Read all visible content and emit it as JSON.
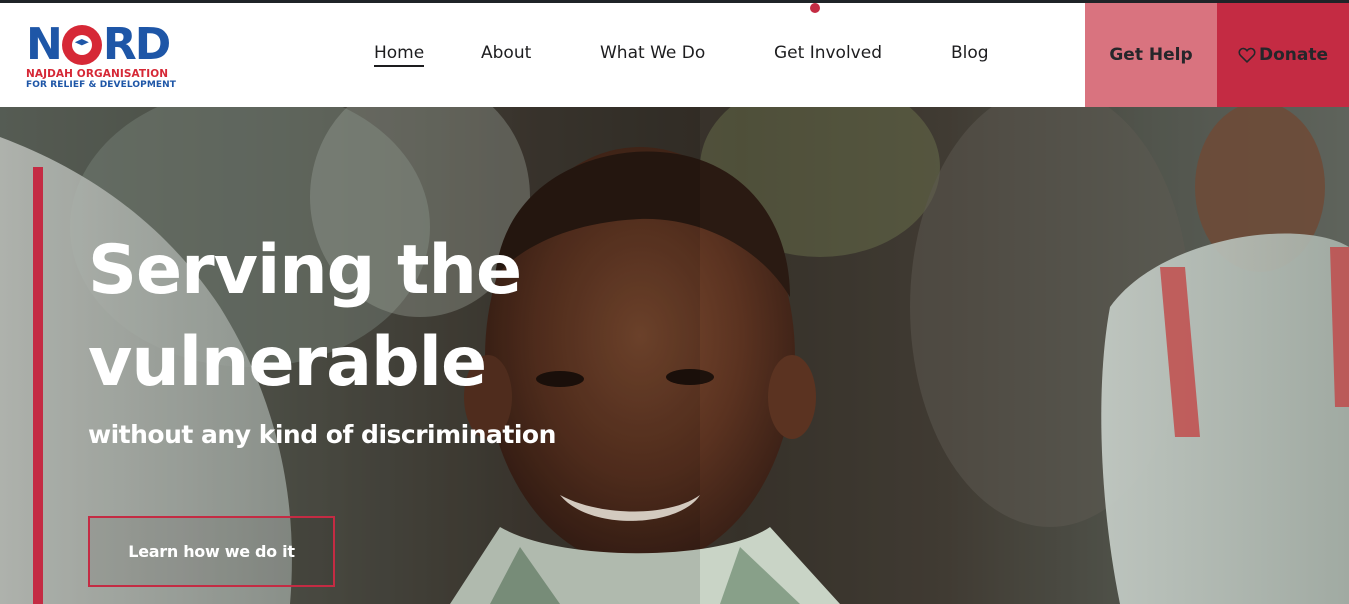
{
  "logo": {
    "word_left": "N",
    "word_right": "RD",
    "line1": "NAJDAH ORGANISATION",
    "line2": "FOR RELIEF & DEVELOPMENT"
  },
  "nav": {
    "items": [
      {
        "label": "Home",
        "active": true
      },
      {
        "label": "About"
      },
      {
        "label": "What We Do"
      },
      {
        "label": "Get Involved"
      },
      {
        "label": "Blog"
      }
    ]
  },
  "actions": {
    "help_label": "Get Help",
    "donate_label": "Donate"
  },
  "hero": {
    "title": "Serving the vulnerable",
    "subtitle": "without any kind of discrimination",
    "cta_label": "Learn how we do it"
  },
  "colors": {
    "brand_red": "#c42b43",
    "help_pink": "#d9737f",
    "logo_blue": "#1e56a7",
    "logo_red": "#d62836"
  }
}
